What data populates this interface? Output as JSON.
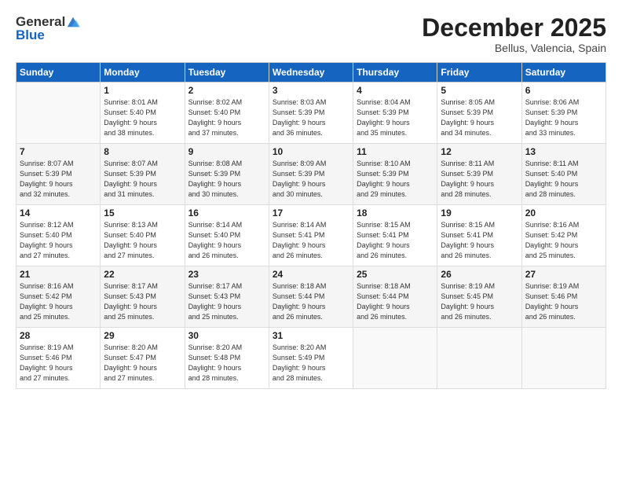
{
  "header": {
    "logo_general": "General",
    "logo_blue": "Blue",
    "month_title": "December 2025",
    "location": "Bellus, Valencia, Spain"
  },
  "days_of_week": [
    "Sunday",
    "Monday",
    "Tuesday",
    "Wednesday",
    "Thursday",
    "Friday",
    "Saturday"
  ],
  "weeks": [
    [
      {
        "day": "",
        "info": ""
      },
      {
        "day": "1",
        "info": "Sunrise: 8:01 AM\nSunset: 5:40 PM\nDaylight: 9 hours\nand 38 minutes."
      },
      {
        "day": "2",
        "info": "Sunrise: 8:02 AM\nSunset: 5:40 PM\nDaylight: 9 hours\nand 37 minutes."
      },
      {
        "day": "3",
        "info": "Sunrise: 8:03 AM\nSunset: 5:39 PM\nDaylight: 9 hours\nand 36 minutes."
      },
      {
        "day": "4",
        "info": "Sunrise: 8:04 AM\nSunset: 5:39 PM\nDaylight: 9 hours\nand 35 minutes."
      },
      {
        "day": "5",
        "info": "Sunrise: 8:05 AM\nSunset: 5:39 PM\nDaylight: 9 hours\nand 34 minutes."
      },
      {
        "day": "6",
        "info": "Sunrise: 8:06 AM\nSunset: 5:39 PM\nDaylight: 9 hours\nand 33 minutes."
      }
    ],
    [
      {
        "day": "7",
        "info": "Sunrise: 8:07 AM\nSunset: 5:39 PM\nDaylight: 9 hours\nand 32 minutes."
      },
      {
        "day": "8",
        "info": "Sunrise: 8:07 AM\nSunset: 5:39 PM\nDaylight: 9 hours\nand 31 minutes."
      },
      {
        "day": "9",
        "info": "Sunrise: 8:08 AM\nSunset: 5:39 PM\nDaylight: 9 hours\nand 30 minutes."
      },
      {
        "day": "10",
        "info": "Sunrise: 8:09 AM\nSunset: 5:39 PM\nDaylight: 9 hours\nand 30 minutes."
      },
      {
        "day": "11",
        "info": "Sunrise: 8:10 AM\nSunset: 5:39 PM\nDaylight: 9 hours\nand 29 minutes."
      },
      {
        "day": "12",
        "info": "Sunrise: 8:11 AM\nSunset: 5:39 PM\nDaylight: 9 hours\nand 28 minutes."
      },
      {
        "day": "13",
        "info": "Sunrise: 8:11 AM\nSunset: 5:40 PM\nDaylight: 9 hours\nand 28 minutes."
      }
    ],
    [
      {
        "day": "14",
        "info": "Sunrise: 8:12 AM\nSunset: 5:40 PM\nDaylight: 9 hours\nand 27 minutes."
      },
      {
        "day": "15",
        "info": "Sunrise: 8:13 AM\nSunset: 5:40 PM\nDaylight: 9 hours\nand 27 minutes."
      },
      {
        "day": "16",
        "info": "Sunrise: 8:14 AM\nSunset: 5:40 PM\nDaylight: 9 hours\nand 26 minutes."
      },
      {
        "day": "17",
        "info": "Sunrise: 8:14 AM\nSunset: 5:41 PM\nDaylight: 9 hours\nand 26 minutes."
      },
      {
        "day": "18",
        "info": "Sunrise: 8:15 AM\nSunset: 5:41 PM\nDaylight: 9 hours\nand 26 minutes."
      },
      {
        "day": "19",
        "info": "Sunrise: 8:15 AM\nSunset: 5:41 PM\nDaylight: 9 hours\nand 26 minutes."
      },
      {
        "day": "20",
        "info": "Sunrise: 8:16 AM\nSunset: 5:42 PM\nDaylight: 9 hours\nand 25 minutes."
      }
    ],
    [
      {
        "day": "21",
        "info": "Sunrise: 8:16 AM\nSunset: 5:42 PM\nDaylight: 9 hours\nand 25 minutes."
      },
      {
        "day": "22",
        "info": "Sunrise: 8:17 AM\nSunset: 5:43 PM\nDaylight: 9 hours\nand 25 minutes."
      },
      {
        "day": "23",
        "info": "Sunrise: 8:17 AM\nSunset: 5:43 PM\nDaylight: 9 hours\nand 25 minutes."
      },
      {
        "day": "24",
        "info": "Sunrise: 8:18 AM\nSunset: 5:44 PM\nDaylight: 9 hours\nand 26 minutes."
      },
      {
        "day": "25",
        "info": "Sunrise: 8:18 AM\nSunset: 5:44 PM\nDaylight: 9 hours\nand 26 minutes."
      },
      {
        "day": "26",
        "info": "Sunrise: 8:19 AM\nSunset: 5:45 PM\nDaylight: 9 hours\nand 26 minutes."
      },
      {
        "day": "27",
        "info": "Sunrise: 8:19 AM\nSunset: 5:46 PM\nDaylight: 9 hours\nand 26 minutes."
      }
    ],
    [
      {
        "day": "28",
        "info": "Sunrise: 8:19 AM\nSunset: 5:46 PM\nDaylight: 9 hours\nand 27 minutes."
      },
      {
        "day": "29",
        "info": "Sunrise: 8:20 AM\nSunset: 5:47 PM\nDaylight: 9 hours\nand 27 minutes."
      },
      {
        "day": "30",
        "info": "Sunrise: 8:20 AM\nSunset: 5:48 PM\nDaylight: 9 hours\nand 28 minutes."
      },
      {
        "day": "31",
        "info": "Sunrise: 8:20 AM\nSunset: 5:49 PM\nDaylight: 9 hours\nand 28 minutes."
      },
      {
        "day": "",
        "info": ""
      },
      {
        "day": "",
        "info": ""
      },
      {
        "day": "",
        "info": ""
      }
    ]
  ]
}
